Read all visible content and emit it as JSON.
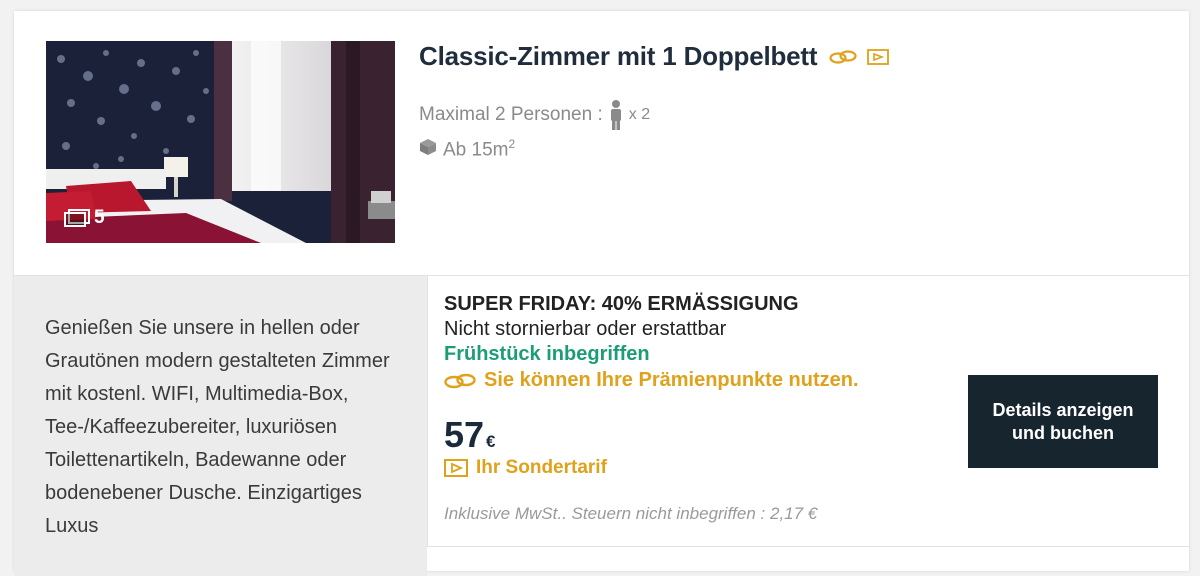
{
  "room": {
    "title": "Classic-Zimmer mit 1 Doppelbett",
    "photo_count": "5",
    "capacity_label": "Maximal 2 Personen :",
    "capacity_value": "x 2",
    "size_prefix": "Ab 15m",
    "size_unit_sup": "2",
    "description": "Genießen Sie unsere in hellen oder Grautönen modern gestalteten Zimmer mit kostenl. WIFI, Multimedia-Box, Tee-/Kaffeezubereiter, luxuriösen Toilettenartikeln, Badewanne oder bodenebener Dusche. Einzigartiges Luxus"
  },
  "offer": {
    "name": "SUPER FRIDAY: 40% ERMÄSSIGUNG",
    "condition": "Nicht stornierbar oder erstattbar",
    "breakfast": "Frühstück inbegriffen",
    "points": "Sie können Ihre Prämienpunkte nutzen.",
    "price": "57",
    "currency": "€",
    "special": "Ihr Sondertarif",
    "tax_note": "Inklusive MwSt.. Steuern nicht inbegriffen : 2,17 €",
    "button_label": "Details anzeigen und buchen"
  },
  "icons": {
    "points": "rings-icon",
    "special_rate": "ticket-icon",
    "person": "person-icon",
    "size": "cube-icon",
    "gallery": "gallery-icon"
  },
  "colors": {
    "brand_dark": "#17252f",
    "gold": "#e0a11b",
    "green": "#1c9d75",
    "muted": "#8a8a8a"
  }
}
